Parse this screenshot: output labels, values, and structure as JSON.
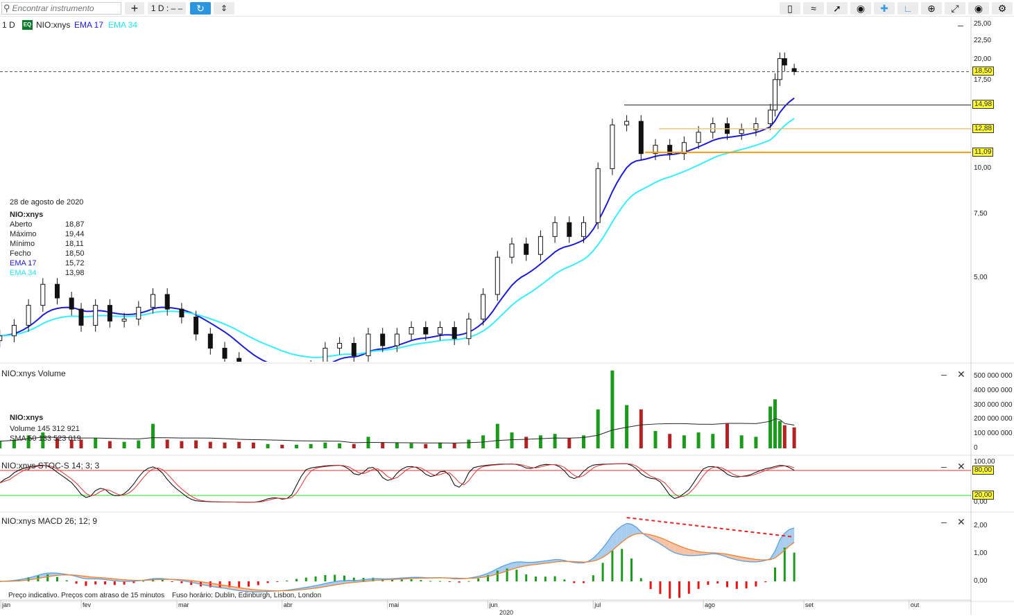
{
  "toolbar": {
    "search_placeholder": "Encontrar instrumento",
    "add_label": "+",
    "interval_label": "1 D : – –",
    "tools": [
      "candles-icon",
      "indicators-icon",
      "draw-line-icon",
      "eye-icon",
      "crosshair-icon",
      "curve-icon",
      "zoom-icon",
      "fullscreen-icon",
      "camera-icon",
      "gear-icon"
    ]
  },
  "main": {
    "interval": "1 D",
    "badge": "EQ",
    "symbol": "NIO:xnys",
    "ema17_label": "EMA 17",
    "ema34_label": "EMA 34",
    "minimize": "–"
  },
  "info": {
    "date": "28 de agosto de 2020",
    "symbol": "NIO:xnys",
    "rows": [
      {
        "k": "Aberto",
        "v": "18,87"
      },
      {
        "k": "Máximo",
        "v": "19,44"
      },
      {
        "k": "Mínimo",
        "v": "18,11"
      },
      {
        "k": "Fecho",
        "v": "18,50"
      },
      {
        "k": "EMA 17",
        "v": "15,72"
      },
      {
        "k": "EMA 34",
        "v": "13,98"
      }
    ]
  },
  "price_axis": {
    "ticks": [
      "25,00",
      "22,50",
      "20,00",
      "17,50",
      "10,00",
      "7,50",
      "5,00"
    ],
    "tick_values": [
      25,
      22.5,
      20,
      17.5,
      10,
      7.5,
      5
    ],
    "scale": "log",
    "last": "18,50",
    "last_value": 18.5,
    "levels": [
      {
        "label": "14,98",
        "value": 14.98,
        "color": "#444444"
      },
      {
        "label": "12,88",
        "value": 12.88,
        "color": "#f5c26b"
      },
      {
        "label": "11,09",
        "value": 11.09,
        "color": "#ff9900"
      }
    ]
  },
  "volume": {
    "title": "NIO:xnys  Volume",
    "symbol": "NIO:xnys",
    "volume_text": "Volume  145 312 921",
    "sma_text": "SMA 50  133 523 019",
    "ticks": [
      "500 000 000",
      "400 000 000",
      "300 000 000",
      "200 000 000",
      "100 000 000",
      "0"
    ],
    "tick_values": [
      500,
      400,
      300,
      200,
      100,
      0
    ]
  },
  "stoch": {
    "title": "NIO:xnys  STOC-S 14; 3; 3",
    "ticks": [
      "100,00",
      "0,00"
    ],
    "upper": "80,00",
    "lower": "20,00"
  },
  "macd": {
    "title": "NIO:xnys  MACD 26; 12; 9",
    "ticks": [
      "2,00",
      "1,00",
      "0,00"
    ],
    "tick_values": [
      2,
      1,
      0
    ],
    "trendline": [
      {
        "date": "2020-07-10",
        "value": 2.3
      },
      {
        "date": "2020-08-28",
        "value": 1.6
      }
    ]
  },
  "footer": {
    "note": "Preço indicativo. Preços com atraso de 15 minutos",
    "tz": "Fuso horário: Dublin, Edinburgh, Lisbon, London"
  },
  "time_axis": {
    "months": [
      {
        "label": "jan",
        "date": "2020-01-08"
      },
      {
        "label": "fev",
        "date": "2020-02-03"
      },
      {
        "label": "mar",
        "date": "2020-03-02"
      },
      {
        "label": "abr",
        "date": "2020-04-01"
      },
      {
        "label": "mai",
        "date": "2020-05-01"
      },
      {
        "label": "jun",
        "date": "2020-06-01"
      },
      {
        "label": "jul",
        "date": "2020-07-01"
      },
      {
        "label": "ago",
        "date": "2020-08-03"
      },
      {
        "label": "set",
        "date": "2020-09-01"
      },
      {
        "label": "out",
        "date": "2020-10-01"
      }
    ],
    "year": "2020"
  },
  "colors": {
    "ema17": "#1a1adb",
    "ema34": "#33eeff",
    "up_volume": "#1a9c1a",
    "down_volume": "#b22222",
    "stoch_k": "#000000",
    "stoch_d": "#e03030",
    "macd_line": "#5aa0e0",
    "signal_line": "#f08030"
  },
  "chart_data": {
    "type": "candlestick",
    "symbol": "NIO:xnys",
    "interval": "1 D",
    "yscale": "log",
    "ylim": [
      2.9,
      26
    ],
    "points": [
      [
        "2020-01-09",
        3.46,
        50
      ],
      [
        "2020-01-14",
        3.7,
        60
      ],
      [
        "2020-01-17",
        4.2,
        90
      ],
      [
        "2020-01-22",
        4.8,
        110
      ],
      [
        "2020-01-27",
        4.4,
        70
      ],
      [
        "2020-01-30",
        4.1,
        60
      ],
      [
        "2020-02-03",
        3.7,
        60
      ],
      [
        "2020-02-06",
        4.2,
        70
      ],
      [
        "2020-02-11",
        3.8,
        50
      ],
      [
        "2020-02-14",
        3.85,
        45
      ],
      [
        "2020-02-19",
        4.15,
        55
      ],
      [
        "2020-02-24",
        4.5,
        170
      ],
      [
        "2020-02-27",
        4.1,
        60
      ],
      [
        "2020-03-03",
        3.9,
        50
      ],
      [
        "2020-03-06",
        3.5,
        55
      ],
      [
        "2020-03-11",
        3.2,
        45
      ],
      [
        "2020-03-16",
        3.0,
        40
      ],
      [
        "2020-03-19",
        2.6,
        45
      ],
      [
        "2020-03-24",
        2.5,
        40
      ],
      [
        "2020-03-27",
        2.6,
        30
      ],
      [
        "2020-04-01",
        2.5,
        25
      ],
      [
        "2020-04-06",
        2.7,
        25
      ],
      [
        "2020-04-09",
        2.85,
        30
      ],
      [
        "2020-04-14",
        3.2,
        40
      ],
      [
        "2020-04-17",
        3.3,
        35
      ],
      [
        "2020-04-22",
        3.05,
        30
      ],
      [
        "2020-04-27",
        3.5,
        80
      ],
      [
        "2020-04-30",
        3.25,
        40
      ],
      [
        "2020-05-05",
        3.5,
        40
      ],
      [
        "2020-05-08",
        3.65,
        35
      ],
      [
        "2020-05-13",
        3.5,
        30
      ],
      [
        "2020-05-18",
        3.65,
        40
      ],
      [
        "2020-05-21",
        3.4,
        35
      ],
      [
        "2020-05-26",
        3.85,
        60
      ],
      [
        "2020-05-29",
        4.5,
        90
      ],
      [
        "2020-06-03",
        5.7,
        170
      ],
      [
        "2020-06-08",
        6.2,
        110
      ],
      [
        "2020-06-11",
        5.8,
        80
      ],
      [
        "2020-06-16",
        6.5,
        90
      ],
      [
        "2020-06-19",
        7.1,
        100
      ],
      [
        "2020-06-24",
        6.5,
        70
      ],
      [
        "2020-06-29",
        7.1,
        90
      ],
      [
        "2020-07-02",
        10.0,
        270
      ],
      [
        "2020-07-07",
        13.2,
        540
      ],
      [
        "2020-07-10",
        13.5,
        300
      ],
      [
        "2020-07-15",
        11.0,
        270
      ],
      [
        "2020-07-20",
        11.6,
        120
      ],
      [
        "2020-07-23",
        11.0,
        100
      ],
      [
        "2020-07-28",
        11.8,
        90
      ],
      [
        "2020-07-31",
        12.6,
        110
      ],
      [
        "2020-08-05",
        13.3,
        100
      ],
      [
        "2020-08-10",
        12.5,
        170
      ],
      [
        "2020-08-13",
        12.8,
        90
      ],
      [
        "2020-08-18",
        13.3,
        80
      ],
      [
        "2020-08-21",
        14.5,
        290
      ],
      [
        "2020-08-24",
        17.6,
        340
      ],
      [
        "2020-08-25",
        20.1,
        190
      ],
      [
        "2020-08-26",
        19.3,
        160
      ],
      [
        "2020-08-28",
        18.5,
        145.3
      ]
    ],
    "points_format": [
      "date",
      "close",
      "volume_millions"
    ],
    "last_bar": {
      "date": "2020-08-28",
      "open": 18.87,
      "high": 19.44,
      "low": 18.11,
      "close": 18.5,
      "volume": 145312921,
      "sma50_volume": 133523019
    }
  }
}
